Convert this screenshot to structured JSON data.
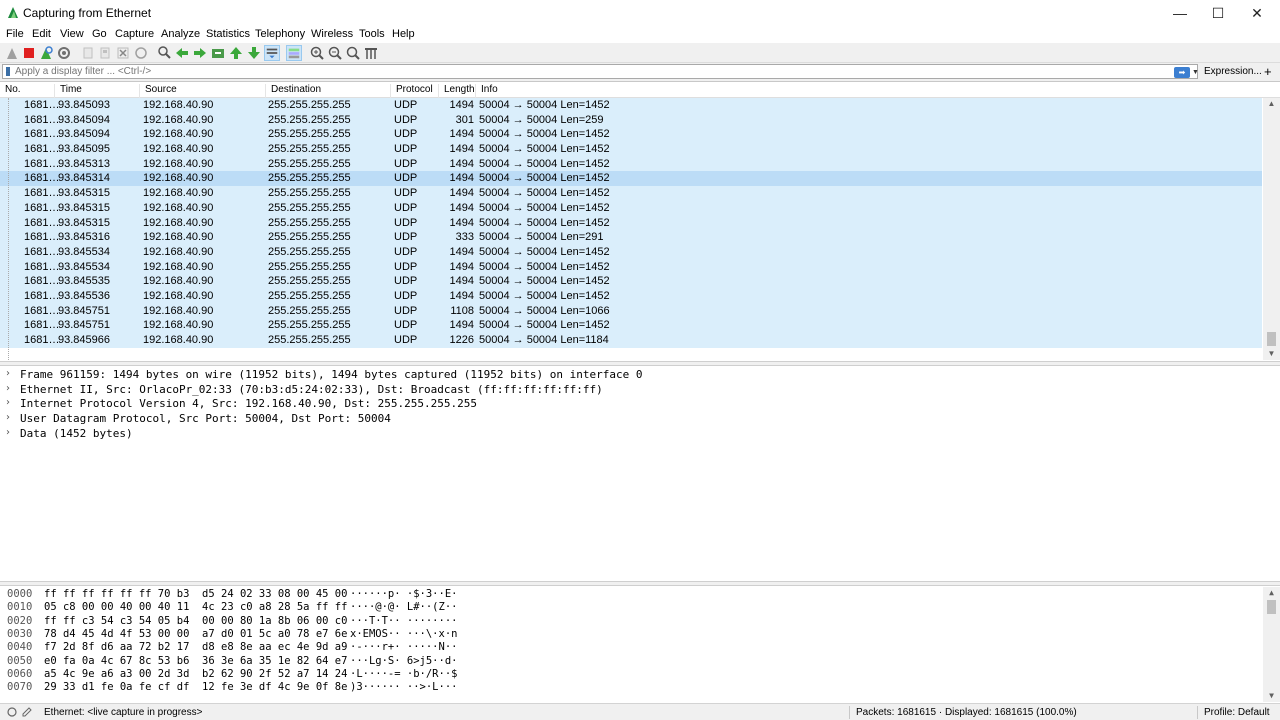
{
  "window": {
    "title": "Capturing from Ethernet",
    "minimize": "—",
    "maximize": "☐",
    "close": "✕"
  },
  "menu": [
    "File",
    "Edit",
    "View",
    "Go",
    "Capture",
    "Analyze",
    "Statistics",
    "Telephony",
    "Wireless",
    "Tools",
    "Help"
  ],
  "toolbar": {
    "icons": [
      "shark-fin-start-icon",
      "stop-capture-icon",
      "restart-capture-icon",
      "capture-options-icon",
      "open-file-icon",
      "save-file-icon",
      "close-file-icon",
      "reload-file-icon",
      "find-packet-icon",
      "go-back-icon",
      "go-forward-icon",
      "go-to-packet-icon",
      "go-first-icon",
      "go-last-icon",
      "autoscroll-icon",
      "colorize-icon",
      "zoom-in-icon",
      "zoom-out-icon",
      "normal-size-icon",
      "resize-columns-icon"
    ],
    "colors": {
      "stop": "#e02020",
      "go": "#3ba83b",
      "accent": "#3c7fd1"
    }
  },
  "filter": {
    "placeholder": "Apply a display filter ... <Ctrl-/>",
    "apply_arrow": "➡",
    "dropdown": "▼",
    "expression": "Expression...",
    "add": "+"
  },
  "packet_list": {
    "columns": [
      "No.",
      "Time",
      "Source",
      "Destination",
      "Protocol",
      "Length",
      "Info"
    ],
    "rows": [
      {
        "no": "1681…",
        "time": "93.845093",
        "src": "192.168.40.90",
        "dst": "255.255.255.255",
        "proto": "UDP",
        "len": "1494",
        "info": "50004 → 50004 Len=1452"
      },
      {
        "no": "1681…",
        "time": "93.845094",
        "src": "192.168.40.90",
        "dst": "255.255.255.255",
        "proto": "UDP",
        "len": "301",
        "info": "50004 → 50004 Len=259"
      },
      {
        "no": "1681…",
        "time": "93.845094",
        "src": "192.168.40.90",
        "dst": "255.255.255.255",
        "proto": "UDP",
        "len": "1494",
        "info": "50004 → 50004 Len=1452"
      },
      {
        "no": "1681…",
        "time": "93.845095",
        "src": "192.168.40.90",
        "dst": "255.255.255.255",
        "proto": "UDP",
        "len": "1494",
        "info": "50004 → 50004 Len=1452"
      },
      {
        "no": "1681…",
        "time": "93.845313",
        "src": "192.168.40.90",
        "dst": "255.255.255.255",
        "proto": "UDP",
        "len": "1494",
        "info": "50004 → 50004 Len=1452"
      },
      {
        "no": "1681…",
        "time": "93.845314",
        "src": "192.168.40.90",
        "dst": "255.255.255.255",
        "proto": "UDP",
        "len": "1494",
        "info": "50004 → 50004 Len=1452",
        "selected": true
      },
      {
        "no": "1681…",
        "time": "93.845315",
        "src": "192.168.40.90",
        "dst": "255.255.255.255",
        "proto": "UDP",
        "len": "1494",
        "info": "50004 → 50004 Len=1452"
      },
      {
        "no": "1681…",
        "time": "93.845315",
        "src": "192.168.40.90",
        "dst": "255.255.255.255",
        "proto": "UDP",
        "len": "1494",
        "info": "50004 → 50004 Len=1452"
      },
      {
        "no": "1681…",
        "time": "93.845315",
        "src": "192.168.40.90",
        "dst": "255.255.255.255",
        "proto": "UDP",
        "len": "1494",
        "info": "50004 → 50004 Len=1452"
      },
      {
        "no": "1681…",
        "time": "93.845316",
        "src": "192.168.40.90",
        "dst": "255.255.255.255",
        "proto": "UDP",
        "len": "333",
        "info": "50004 → 50004 Len=291"
      },
      {
        "no": "1681…",
        "time": "93.845534",
        "src": "192.168.40.90",
        "dst": "255.255.255.255",
        "proto": "UDP",
        "len": "1494",
        "info": "50004 → 50004 Len=1452"
      },
      {
        "no": "1681…",
        "time": "93.845534",
        "src": "192.168.40.90",
        "dst": "255.255.255.255",
        "proto": "UDP",
        "len": "1494",
        "info": "50004 → 50004 Len=1452"
      },
      {
        "no": "1681…",
        "time": "93.845535",
        "src": "192.168.40.90",
        "dst": "255.255.255.255",
        "proto": "UDP",
        "len": "1494",
        "info": "50004 → 50004 Len=1452"
      },
      {
        "no": "1681…",
        "time": "93.845536",
        "src": "192.168.40.90",
        "dst": "255.255.255.255",
        "proto": "UDP",
        "len": "1494",
        "info": "50004 → 50004 Len=1452"
      },
      {
        "no": "1681…",
        "time": "93.845751",
        "src": "192.168.40.90",
        "dst": "255.255.255.255",
        "proto": "UDP",
        "len": "1108",
        "info": "50004 → 50004 Len=1066"
      },
      {
        "no": "1681…",
        "time": "93.845751",
        "src": "192.168.40.90",
        "dst": "255.255.255.255",
        "proto": "UDP",
        "len": "1494",
        "info": "50004 → 50004 Len=1452"
      },
      {
        "no": "1681…",
        "time": "93.845966",
        "src": "192.168.40.90",
        "dst": "255.255.255.255",
        "proto": "UDP",
        "len": "1226",
        "info": "50004 → 50004 Len=1184"
      }
    ],
    "row_color": "#daeefb",
    "selected_color": "#bcdcf6"
  },
  "details": [
    "Frame 961159: 1494 bytes on wire (11952 bits), 1494 bytes captured (11952 bits) on interface 0",
    "Ethernet II, Src: OrlacoPr_02:33 (70:b3:d5:24:02:33), Dst: Broadcast (ff:ff:ff:ff:ff:ff)",
    "Internet Protocol Version 4, Src: 192.168.40.90, Dst: 255.255.255.255",
    "User Datagram Protocol, Src Port: 50004, Dst Port: 50004",
    "Data (1452 bytes)"
  ],
  "bytes": [
    {
      "off": "0000",
      "hex": "ff ff ff ff ff ff 70 b3  d5 24 02 33 08 00 45 00",
      "ascii": "······p· ·$·3··E·"
    },
    {
      "off": "0010",
      "hex": "05 c8 00 00 40 00 40 11  4c 23 c0 a8 28 5a ff ff",
      "ascii": "····@·@· L#··(Z··"
    },
    {
      "off": "0020",
      "hex": "ff ff c3 54 c3 54 05 b4  00 00 80 1a 8b 06 00 c0",
      "ascii": "···T·T·· ········"
    },
    {
      "off": "0030",
      "hex": "78 d4 45 4d 4f 53 00 00  a7 d0 01 5c a0 78 e7 6e",
      "ascii": "x·EMOS·· ···\\·x·n"
    },
    {
      "off": "0040",
      "hex": "f7 2d 8f d6 aa 72 b2 17  d8 e8 8e aa ec 4e 9d a9",
      "ascii": "·-···r+· ·····N··"
    },
    {
      "off": "0050",
      "hex": "e0 fa 0a 4c 67 8c 53 b6  36 3e 6a 35 1e 82 64 e7",
      "ascii": "···Lg·S· 6>j5··d·"
    },
    {
      "off": "0060",
      "hex": "a5 4c 9e a6 a3 00 2d 3d  b2 62 90 2f 52 a7 14 24",
      "ascii": "·L····-= ·b·/R··$"
    },
    {
      "off": "0070",
      "hex": "29 33 d1 fe 0a fe cf df  12 fe 3e df 4c 9e 0f 8e",
      "ascii": ")3······ ··>·L···"
    }
  ],
  "status": {
    "interface": "Ethernet: <live capture in progress>",
    "packets": "Packets: 1681615 · Displayed: 1681615 (100.0%)",
    "profile": "Profile: Default"
  }
}
